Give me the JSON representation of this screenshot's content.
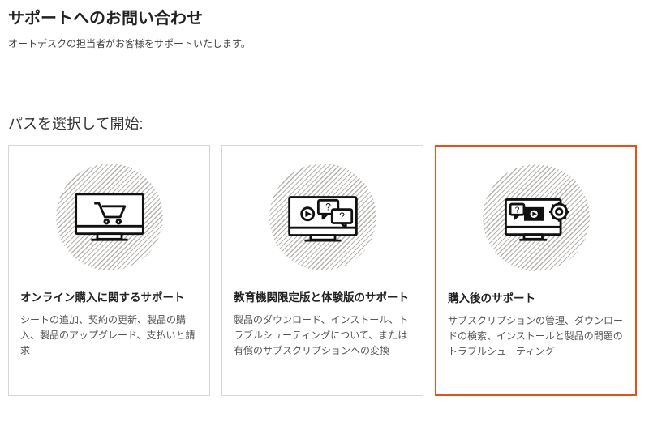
{
  "header": {
    "title": "サポートへのお問い合わせ",
    "subtitle": "オートデスクの担当者がお客様をサポートいたします。"
  },
  "section_heading": "パスを選択して開始:",
  "cards": [
    {
      "title": "オンライン購入に関するサポート",
      "desc": "シートの追加、契約の更新、製品の購入、製品のアップグレード、支払いと請求",
      "selected": false
    },
    {
      "title": "教育機関限定版と体験版のサポート",
      "desc": "製品のダウンロード、インストール、トラブルシューティングについて、または有償のサブスクリプションへの変換",
      "selected": false
    },
    {
      "title": "購入後のサポート",
      "desc": "サブスクリプションの管理、ダウンロードの検索、インストールと製品の問題のトラブルシューティング",
      "selected": true
    }
  ]
}
